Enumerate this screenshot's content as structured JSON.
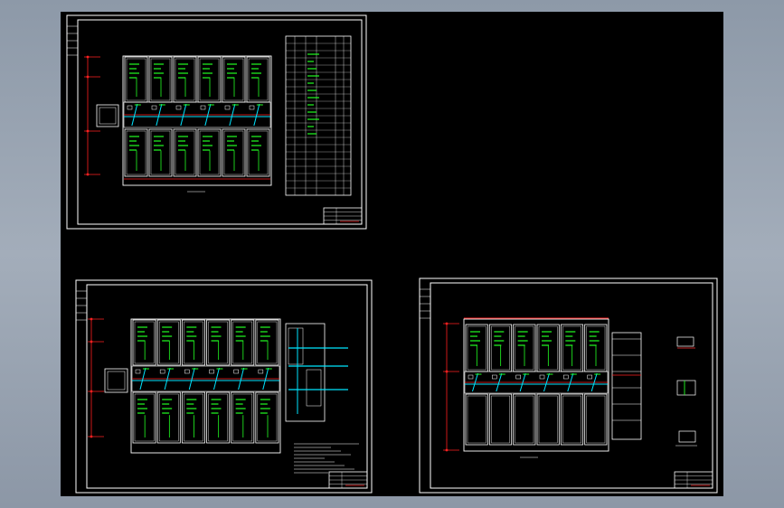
{
  "viewer": {
    "background_color": "#9aa4b2",
    "canvas_color": "#000000"
  },
  "colors": {
    "frame": "#ffffff",
    "wall": "#ffffff",
    "axis_red": "#ff2020",
    "label_green": "#22ff22",
    "pipe_cyan": "#00e5ff",
    "title_red": "#ff3030"
  },
  "sheets": [
    {
      "id": "sheet-top-left",
      "rooms_per_row": 6
    },
    {
      "id": "sheet-bottom-left",
      "rooms_per_row": 6
    },
    {
      "id": "sheet-bottom-right",
      "rooms_per_row": 6
    }
  ]
}
